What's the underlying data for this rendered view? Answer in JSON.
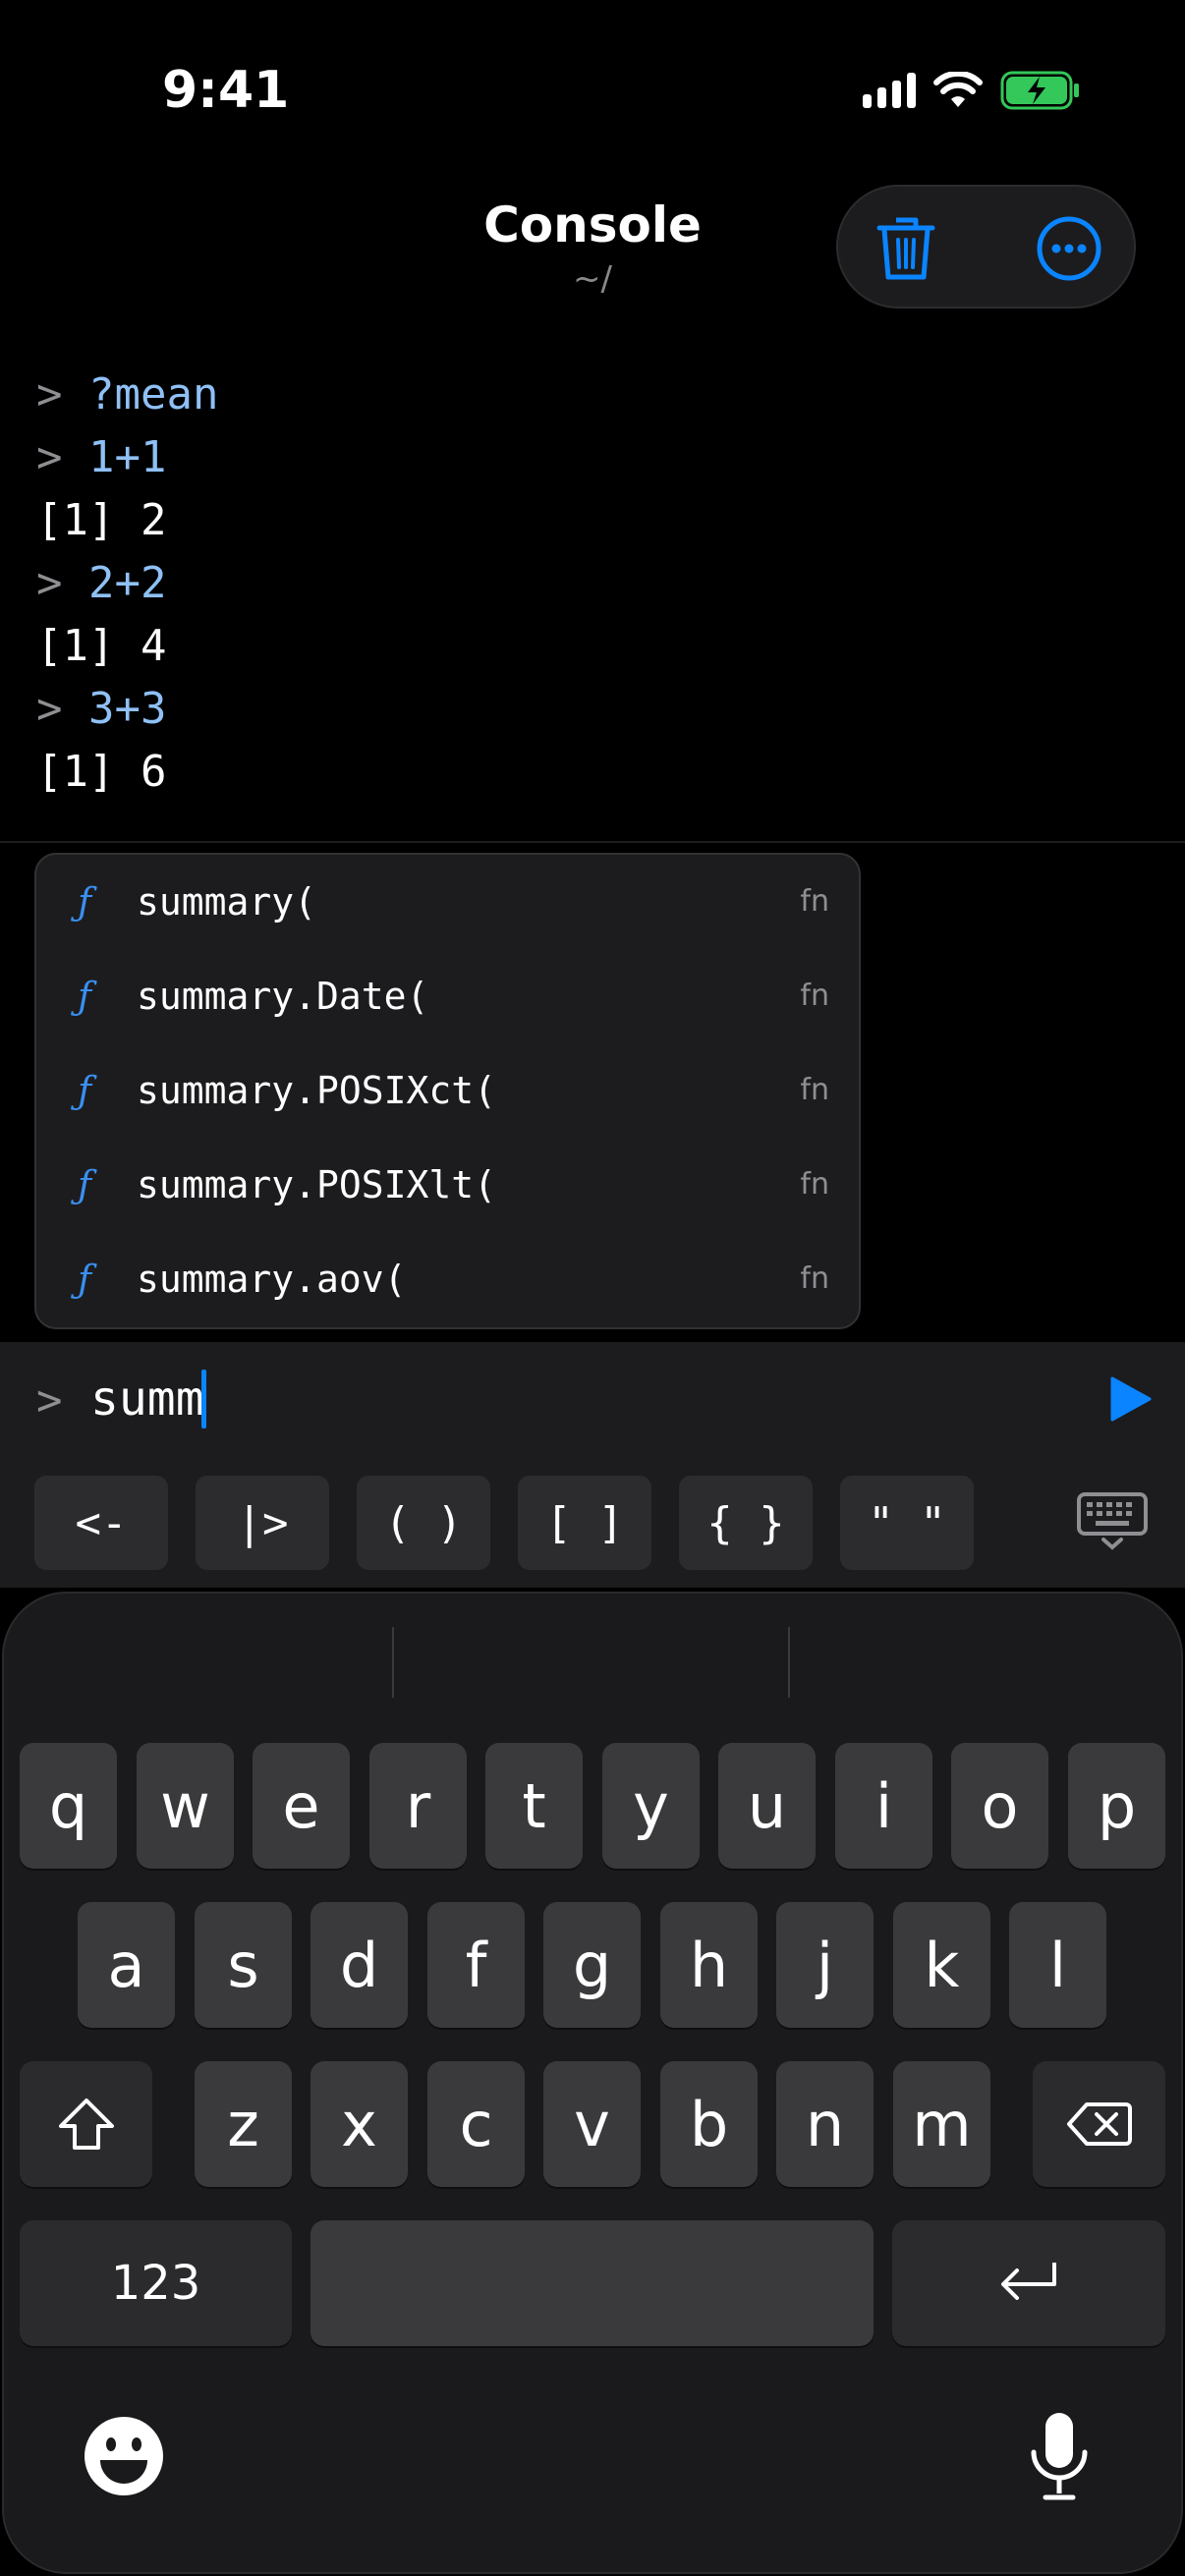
{
  "status_bar": {
    "time": "9:41"
  },
  "header": {
    "title": "Console",
    "subtitle": "~/"
  },
  "console": {
    "lines": [
      {
        "prompt": ">",
        "text": "?mean",
        "type": "cmd"
      },
      {
        "prompt": ">",
        "text": "1+1",
        "type": "cmd"
      },
      {
        "prompt": "",
        "text": "[1] 2",
        "type": "out"
      },
      {
        "prompt": ">",
        "text": "2+2",
        "type": "cmd"
      },
      {
        "prompt": "",
        "text": "[1] 4",
        "type": "out"
      },
      {
        "prompt": ">",
        "text": "3+3",
        "type": "cmd"
      },
      {
        "prompt": "",
        "text": "[1] 6",
        "type": "out"
      }
    ]
  },
  "autocomplete": {
    "items": [
      {
        "icon": "ƒ",
        "label": "summary(",
        "kind": "fn"
      },
      {
        "icon": "ƒ",
        "label": "summary.Date(",
        "kind": "fn"
      },
      {
        "icon": "ƒ",
        "label": "summary.POSIXct(",
        "kind": "fn"
      },
      {
        "icon": "ƒ",
        "label": "summary.POSIXlt(",
        "kind": "fn"
      },
      {
        "icon": "ƒ",
        "label": "summary.aov(",
        "kind": "fn"
      }
    ]
  },
  "input": {
    "prompt": ">",
    "value": "summ"
  },
  "symbols": [
    "<-",
    "|>",
    "( )",
    "[ ]",
    "{ }",
    "\" \""
  ],
  "keyboard": {
    "row1": [
      "q",
      "w",
      "e",
      "r",
      "t",
      "y",
      "u",
      "i",
      "o",
      "p"
    ],
    "row2": [
      "a",
      "s",
      "d",
      "f",
      "g",
      "h",
      "j",
      "k",
      "l"
    ],
    "row3": [
      "z",
      "x",
      "c",
      "v",
      "b",
      "n",
      "m"
    ],
    "numbers_key": "123"
  },
  "colors": {
    "accent": "#0a84ff",
    "command": "#8fc0f5",
    "battery": "#34c759"
  }
}
